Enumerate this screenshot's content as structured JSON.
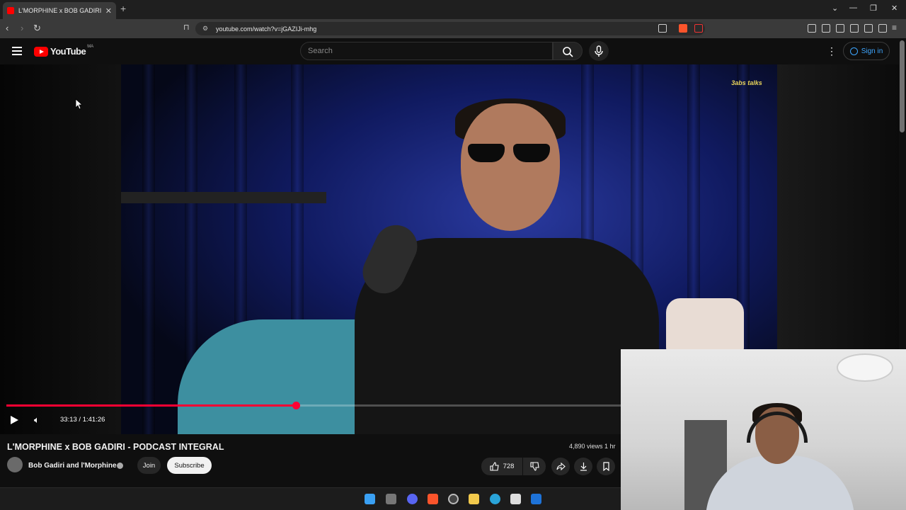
{
  "browser": {
    "tab_title": "L'MORPHINE x BOB GADIRI - PC",
    "tab_close": "✕",
    "new_tab": "+",
    "url": "youtube.com/watch?v=jGAZIJi-mhg",
    "window_controls": [
      "⌄",
      "—",
      "❐",
      "✕"
    ]
  },
  "youtube": {
    "logo_text": "YouTube",
    "country_code": "MA",
    "search_placeholder": "Search",
    "sign_in_label": "Sign in"
  },
  "player": {
    "brand_logo_text": "3abs talks",
    "current_time": "33:13",
    "duration": "1:41:26",
    "time_display": "33:13 / 1:41:26",
    "progress_fraction": 0.327
  },
  "video": {
    "title": "L'MORPHINE x BOB GADIRI - PODCAST INTEGRAL",
    "views": "4,890 views  1 hr",
    "channel_name": "Bob Gadiri and l'Morphine",
    "join_label": "Join",
    "subscribe_label": "Subscribe",
    "like_count": "728"
  },
  "colors": {
    "youtube_red": "#ff0000",
    "progress_red": "#ff0033",
    "link_blue": "#3ea6ff"
  },
  "icons": {
    "back": "back-arrow-icon",
    "forward": "forward-arrow-icon",
    "reload": "reload-icon",
    "bookmark": "bookmark-icon",
    "menu": "hamburger-menu-icon",
    "search": "search-icon",
    "mic": "microphone-icon",
    "more": "kebab-menu-icon",
    "play": "play-icon",
    "volume": "volume-icon",
    "like": "thumbs-up-icon",
    "dislike": "thumbs-down-icon",
    "share": "share-icon",
    "download": "download-icon",
    "save": "save-icon"
  }
}
